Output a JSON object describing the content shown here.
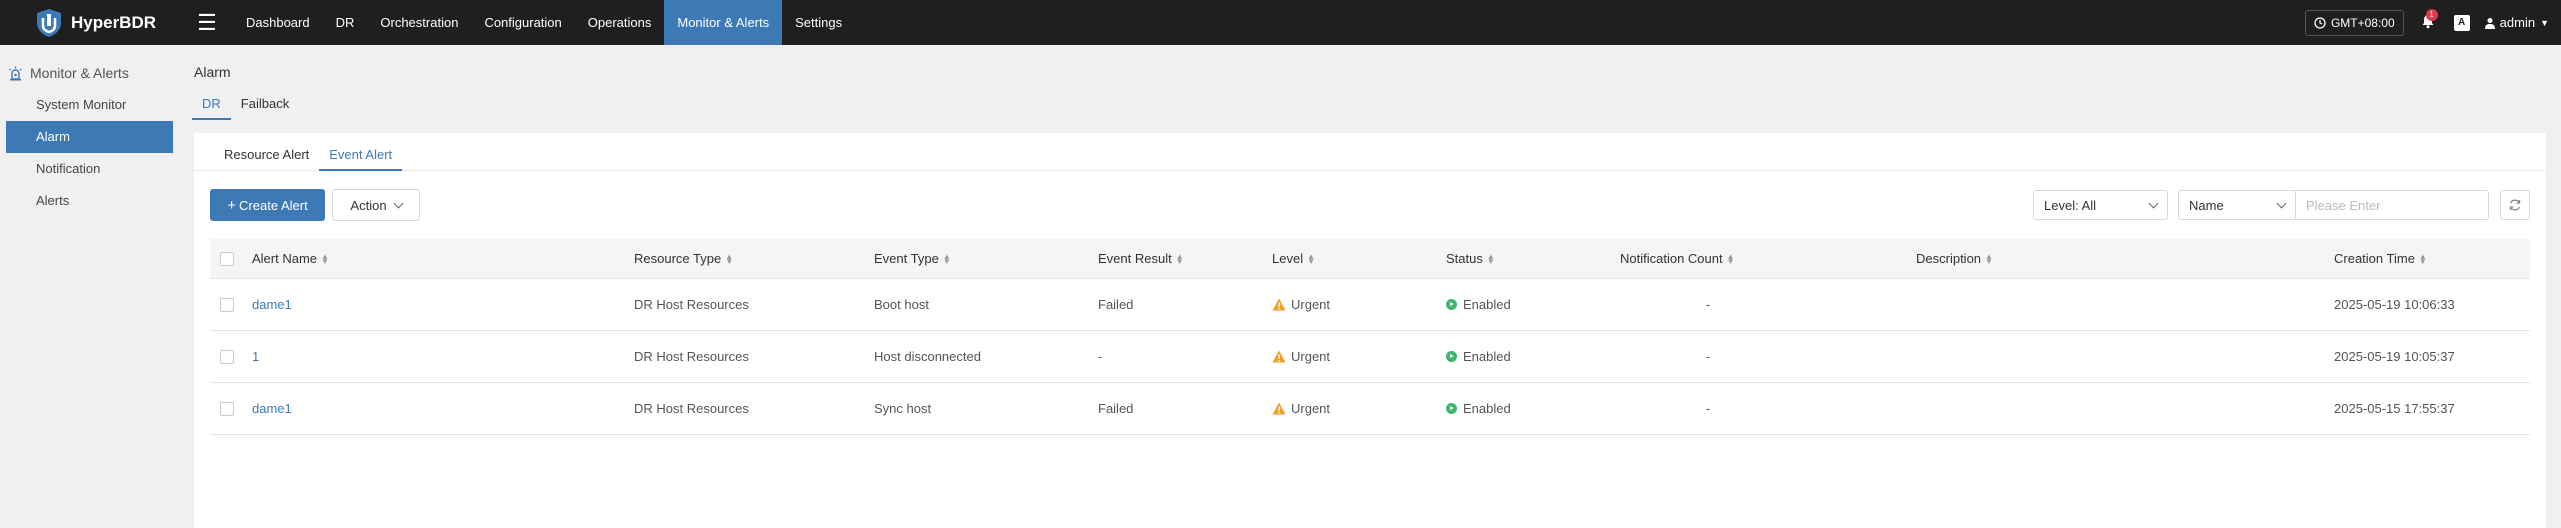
{
  "app": {
    "name": "HyperBDR"
  },
  "topnav": [
    {
      "label": "Dashboard",
      "active": false
    },
    {
      "label": "DR",
      "active": false
    },
    {
      "label": "Orchestration",
      "active": false
    },
    {
      "label": "Configuration",
      "active": false
    },
    {
      "label": "Operations",
      "active": false
    },
    {
      "label": "Monitor & Alerts",
      "active": true
    },
    {
      "label": "Settings",
      "active": false
    }
  ],
  "header_right": {
    "timezone": "GMT+08:00",
    "alert_count": "1",
    "lang_label": "A",
    "user": "admin"
  },
  "sidebar": {
    "group_label": "Monitor & Alerts",
    "items": [
      {
        "label": "System Monitor",
        "active": false
      },
      {
        "label": "Alarm",
        "active": true
      },
      {
        "label": "Notification",
        "active": false
      },
      {
        "label": "Alerts",
        "active": false
      }
    ]
  },
  "page": {
    "title": "Alarm",
    "tabs": [
      "DR",
      "Failback"
    ],
    "inner_tabs": [
      "Resource Alert",
      "Event Alert"
    ]
  },
  "toolbar": {
    "create_label": "Create Alert",
    "action_label": "Action",
    "level_filter": "Level: All",
    "field_select": "Name",
    "search_placeholder": "Please Enter"
  },
  "table": {
    "columns": [
      "Alert Name",
      "Resource Type",
      "Event Type",
      "Event Result",
      "Level",
      "Status",
      "Notification Count",
      "Description",
      "Creation Time"
    ],
    "rows": [
      {
        "name": "dame1",
        "resource_type": "DR Host Resources",
        "event_type": "Boot host",
        "event_result": "Failed",
        "level": "Urgent",
        "status": "Enabled",
        "notification_count": "-",
        "description": "",
        "creation_time": "2025-05-19 10:06:33"
      },
      {
        "name": "1",
        "resource_type": "DR Host Resources",
        "event_type": "Host disconnected",
        "event_result": "-",
        "level": "Urgent",
        "status": "Enabled",
        "notification_count": "-",
        "description": "",
        "creation_time": "2025-05-19 10:05:37"
      },
      {
        "name": "dame1",
        "resource_type": "DR Host Resources",
        "event_type": "Sync host",
        "event_result": "Failed",
        "level": "Urgent",
        "status": "Enabled",
        "notification_count": "-",
        "description": "",
        "creation_time": "2025-05-15 17:55:37"
      }
    ]
  },
  "colors": {
    "accent": "#3c79b5",
    "topbar": "#1f1f1f",
    "warning": "#f0a020",
    "success": "#3db56b"
  }
}
